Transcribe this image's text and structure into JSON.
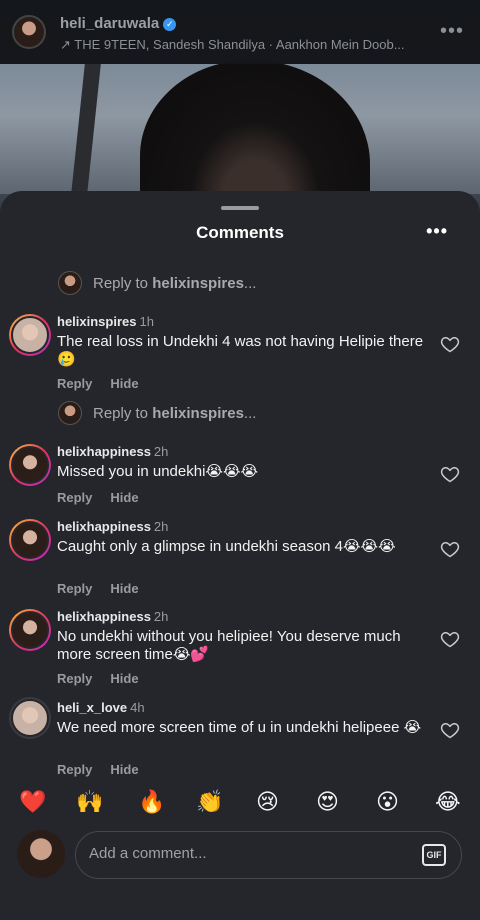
{
  "reel": {
    "username": "heli_daruwala",
    "audio_arrow": "↗",
    "audio": "THE 9TEEN, Sandesh Shandilya · Aankhon Mein Doob...",
    "more": "•••"
  },
  "sheet": {
    "title": "Comments",
    "more": "•••"
  },
  "reply_prompts": [
    {
      "prefix": "Reply to ",
      "user": "helixinspires",
      "suffix": "..."
    },
    {
      "prefix": "Reply to ",
      "user": "helixinspires",
      "suffix": "..."
    }
  ],
  "comments": [
    {
      "user": "helixinspires",
      "time": "1h",
      "text": "The real loss in Undekhi 4 was not having Helipie there 🥲",
      "reply": "Reply",
      "hide": "Hide"
    },
    {
      "user": "helixhappiness",
      "time": "2h",
      "text": "Missed you in undekhi😭😭😭",
      "reply": "Reply",
      "hide": "Hide"
    },
    {
      "user": "helixhappiness",
      "time": "2h",
      "text": "Caught only a glimpse in undekhi season 4😭😭😭",
      "reply": "Reply",
      "hide": "Hide"
    },
    {
      "user": "helixhappiness",
      "time": "2h",
      "text": "No undekhi without you helipiee! You deserve much more screen time😭💕",
      "reply": "Reply",
      "hide": "Hide"
    },
    {
      "user": "heli_x_love",
      "time": "4h",
      "text": "We need more screen time of u in undekhi helipeee 😭",
      "reply": "Reply",
      "hide": "Hide"
    }
  ],
  "quick_reactions": [
    "❤️",
    "🙌",
    "🔥",
    "👏",
    "😢",
    "😍",
    "😮",
    "😂"
  ],
  "composer": {
    "placeholder": "Add a comment...",
    "gif": "GIF"
  },
  "icons": {
    "verified": "verified-badge-icon",
    "heart": "heart-outline-icon",
    "gif": "gif-icon"
  },
  "colors": {
    "sheet_bg": "#25262b",
    "verified": "#3897f0",
    "story_ring": "#e4325d"
  }
}
